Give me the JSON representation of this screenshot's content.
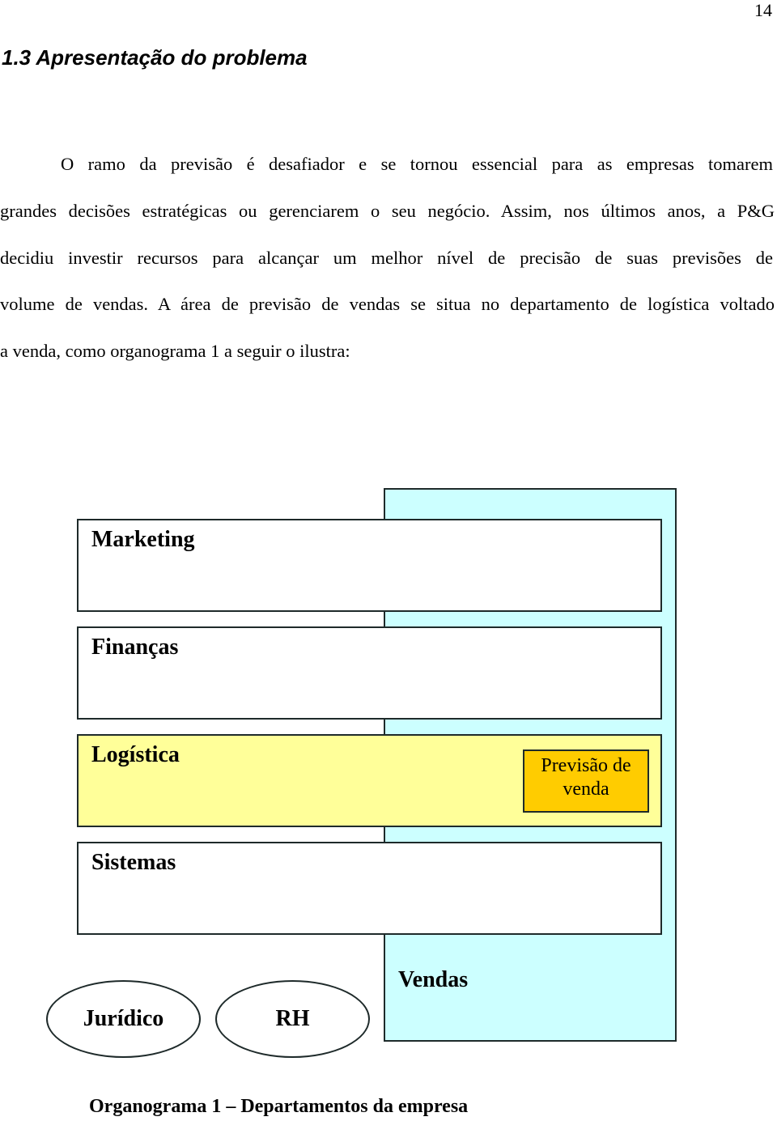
{
  "page_number": "14",
  "heading": "1.3  Apresentação do problema",
  "paragraph_lines": [
    "O ramo da previsão é desafiador e se tornou essencial para as empresas tomarem",
    "grandes decisões estratégicas ou gerenciarem o seu negócio. Assim, nos últimos anos, a P&G",
    "decidiu investir recursos para alcançar um melhor nível de precisão de suas previsões de",
    "volume de vendas. A área de previsão de vendas se situa no departamento de logística voltado",
    "a venda, como organograma 1 a seguir o ilustra:"
  ],
  "org_chart": {
    "vendas": "Vendas",
    "departments": [
      "Marketing",
      "Finanças",
      "Logística",
      "Sistemas"
    ],
    "previsao": "Previsão de venda",
    "ellipses": [
      "Jurídico",
      "RH"
    ],
    "colors": {
      "vendas": "#ccffff",
      "logistica": "#ffff99",
      "previsao": "#ffcc00"
    }
  },
  "caption": "Organograma 1 – Departamentos da empresa"
}
